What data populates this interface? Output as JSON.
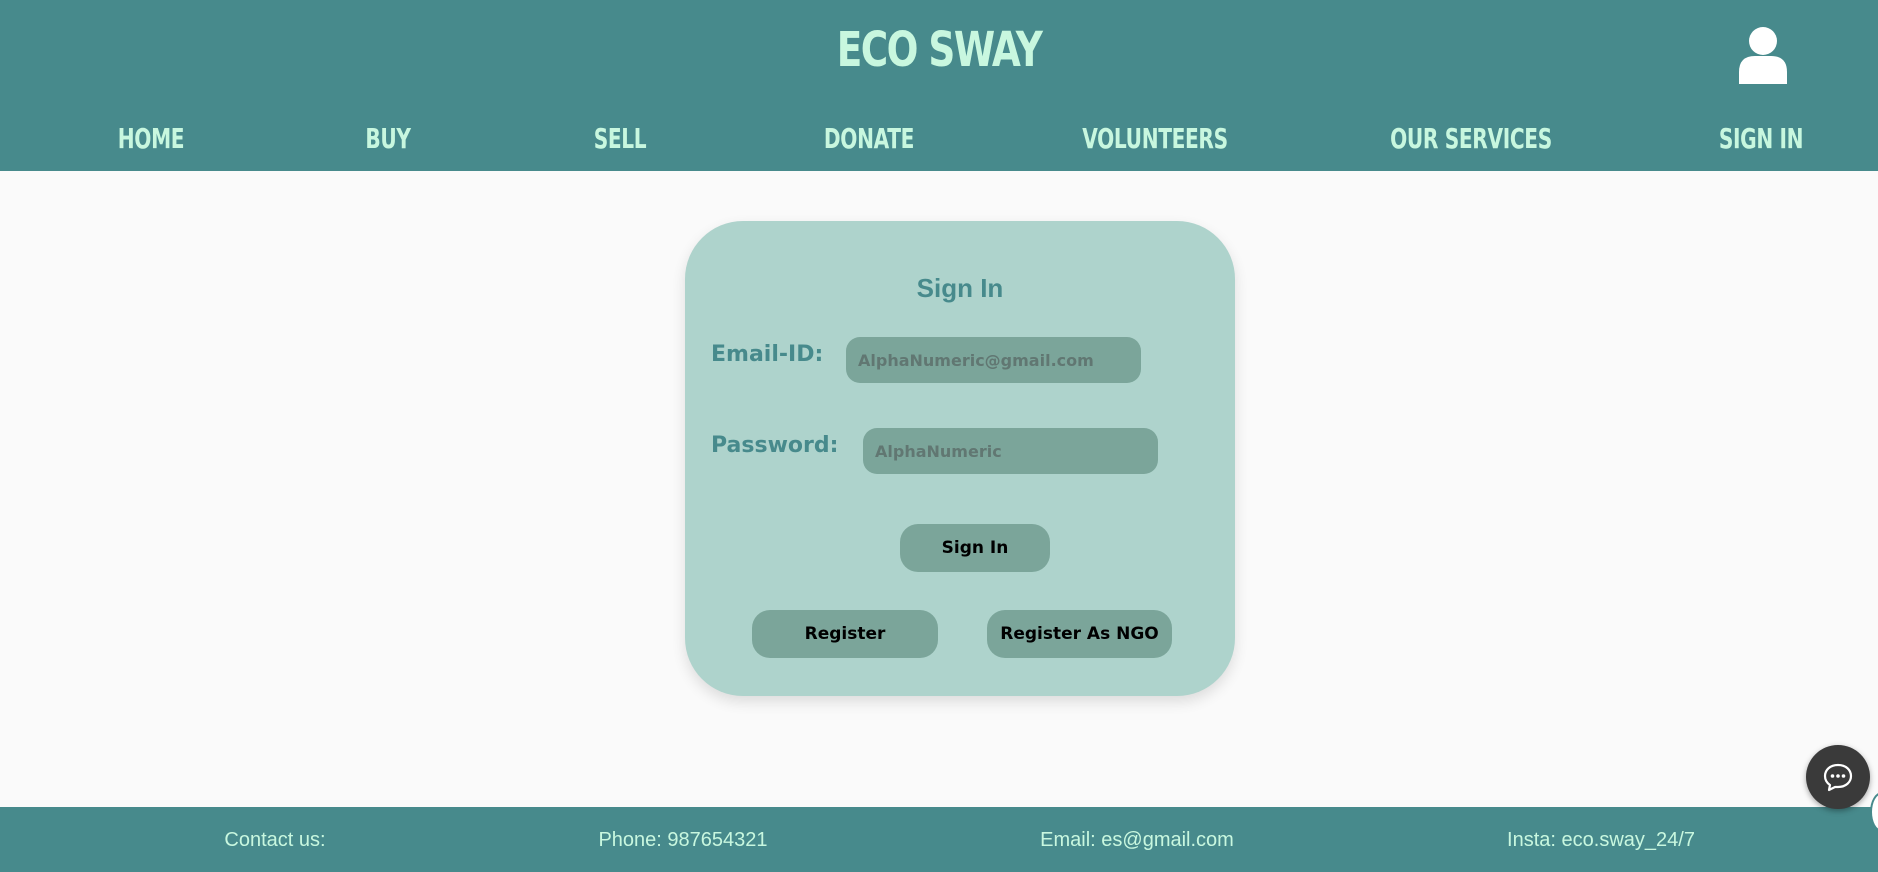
{
  "header": {
    "brand": "ECO SWAY",
    "profile_icon": "user-icon",
    "nav": [
      {
        "label": "HOME"
      },
      {
        "label": "BUY"
      },
      {
        "label": "SELL"
      },
      {
        "label": "DONATE"
      },
      {
        "label": "VOLUNTEERS"
      },
      {
        "label": "OUR SERVICES"
      },
      {
        "label": "SIGN IN"
      }
    ]
  },
  "signin": {
    "title": "Sign In",
    "email_label": "Email-ID:",
    "email_placeholder": "AlphaNumeric@gmail.com",
    "password_label": "Password:",
    "password_placeholder": "AlphaNumeric",
    "submit_label": "Sign In",
    "register_label": "Register",
    "register_ngo_label": "Register As NGO"
  },
  "footer": {
    "contact": "Contact us:",
    "phone": "Phone: 987654321",
    "email": "Email: es@gmail.com",
    "insta": "Insta: eco.sway_24/7"
  },
  "chat": {
    "icon": "chat-bubble-icon"
  },
  "colors": {
    "header_bg": "#478a8c",
    "accent_text": "#c8f7df",
    "card_bg": "#aed3cc",
    "input_bg": "#7ba59a",
    "page_bg": "#fafafa"
  }
}
